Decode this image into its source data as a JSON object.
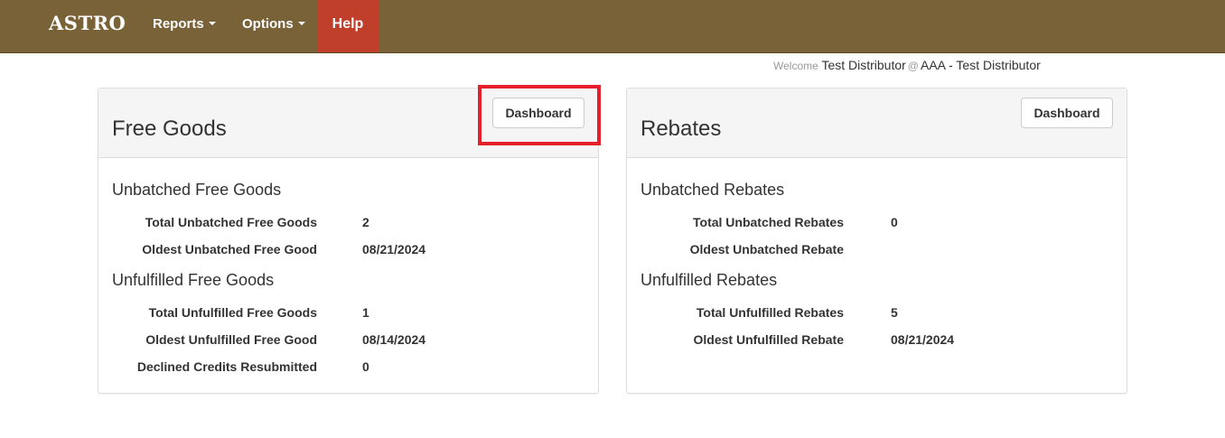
{
  "navbar": {
    "brand": "ASTRO",
    "reports_label": "Reports",
    "options_label": "Options",
    "help_label": "Help"
  },
  "welcome": {
    "prefix": "Welcome",
    "user": "Test Distributor",
    "at": "@",
    "company": "AAA - Test Distributor"
  },
  "free_goods": {
    "title": "Free Goods",
    "dashboard_label": "Dashboard",
    "unbatched": {
      "title": "Unbatched Free Goods",
      "rows": [
        {
          "label": "Total Unbatched Free Goods",
          "value": "2"
        },
        {
          "label": "Oldest Unbatched Free Good",
          "value": "08/21/2024"
        }
      ]
    },
    "unfulfilled": {
      "title": "Unfulfilled Free Goods",
      "rows": [
        {
          "label": "Total Unfulfilled Free Goods",
          "value": "1"
        },
        {
          "label": "Oldest Unfulfilled Free Good",
          "value": "08/14/2024"
        },
        {
          "label": "Declined Credits Resubmitted",
          "value": "0"
        }
      ]
    }
  },
  "rebates": {
    "title": "Rebates",
    "dashboard_label": "Dashboard",
    "unbatched": {
      "title": "Unbatched Rebates",
      "rows": [
        {
          "label": "Total Unbatched Rebates",
          "value": "0"
        },
        {
          "label": "Oldest Unbatched Rebate",
          "value": ""
        }
      ]
    },
    "unfulfilled": {
      "title": "Unfulfilled Rebates",
      "rows": [
        {
          "label": "Total Unfulfilled Rebates",
          "value": "5"
        },
        {
          "label": "Oldest Unfulfilled Rebate",
          "value": "08/21/2024"
        }
      ]
    }
  },
  "colors": {
    "navbar_bg": "#7a6238",
    "help_bg": "#bf3f2b",
    "highlight_border": "#e5202b"
  }
}
